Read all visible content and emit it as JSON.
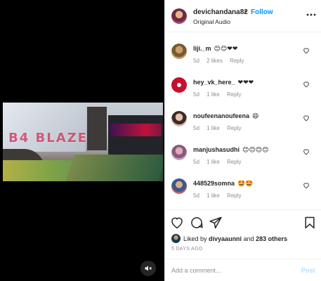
{
  "post": {
    "username": "devichandana82",
    "separator": "•",
    "follow_label": "Follow",
    "subtitle": "Original Audio",
    "more_icon": "more-horizontal-icon"
  },
  "video": {
    "watermark": "B4 BLAZE",
    "mute_icon": "speaker-muted-icon"
  },
  "comments": [
    {
      "username": "liji._m",
      "text": "😊😊❤❤",
      "age": "5d",
      "likes": "2 likes",
      "reply": "Reply"
    },
    {
      "username": "hey_vk_here_",
      "text": "❤❤❤",
      "age": "5d",
      "likes": "1 like",
      "reply": "Reply"
    },
    {
      "username": "noufeenanoufeena",
      "text": "😄",
      "age": "5d",
      "likes": "1 like",
      "reply": "Reply"
    },
    {
      "username": "manjushasudhi",
      "text": "😊😊😊😊",
      "age": "5d",
      "likes": "1 like",
      "reply": "Reply"
    },
    {
      "username": "448529somna",
      "text": "🤩🤩",
      "age": "5d",
      "likes": "1 like",
      "reply": "Reply"
    }
  ],
  "likes": {
    "prefix": "Liked by",
    "user": "divyaaunni",
    "middle": "and",
    "others": "283 others"
  },
  "time_ago": "5 DAYS AGO",
  "add_comment": {
    "placeholder": "Add a comment...",
    "post_label": "Post"
  },
  "colors": {
    "link": "#0095f6",
    "post_disabled": "#b2dffc",
    "muted_text": "#8e8e8e",
    "heart_red": "#ed4956"
  }
}
